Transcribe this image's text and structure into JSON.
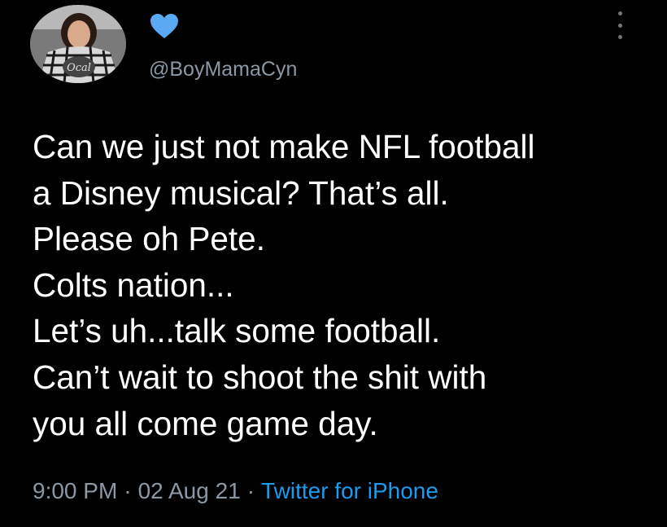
{
  "author": {
    "handle": "@BoyMamaCyn",
    "heart_icon": "heart-icon",
    "heart_color": "#5aa9f5",
    "avatar_badge_text": "Ocal"
  },
  "tweet": {
    "lines": [
      "Can we just not make NFL football",
      "a Disney musical? That’s all.",
      "Please oh Pete.",
      "Colts nation...",
      "Let’s uh...talk some football.",
      "Can’t wait to shoot the shit with",
      "you all come game day."
    ]
  },
  "meta": {
    "time": "9:00 PM",
    "date": "02 Aug 21",
    "separator": "·",
    "source": "Twitter for iPhone"
  },
  "colors": {
    "background": "#000000",
    "text": "#ffffff",
    "secondary": "#8b98a5",
    "link": "#1d9bf0"
  }
}
